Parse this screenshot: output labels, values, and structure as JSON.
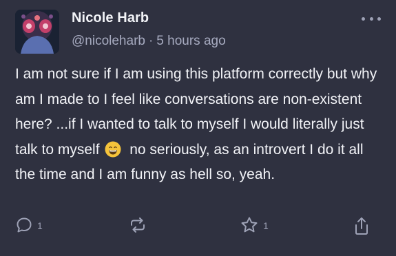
{
  "post": {
    "author_name": "Nicole Harb",
    "handle": "@nicoleharb",
    "separator": "·",
    "time": "5 hours ago",
    "text_before_emoji": "I am not sure if I am using this platform correctly but why am I made to I feel like conversations are non-existent here? ...if I wanted to talk to myself I would literally just talk to myself",
    "emoji": "grinning-face-with-smiling-eyes",
    "text_after_emoji": "no seriously, as an introvert I do it all the time and I am funny as hell so, yeah."
  },
  "actions": {
    "reply_count": "1",
    "like_count": "1"
  },
  "icons": {
    "more": "more-horizontal-icon",
    "reply": "reply-icon",
    "repost": "repost-icon",
    "like": "star-icon",
    "share": "share-icon"
  },
  "colors": {
    "background": "#2f3140",
    "text": "#f2f3f7",
    "muted": "#a7abc0"
  }
}
